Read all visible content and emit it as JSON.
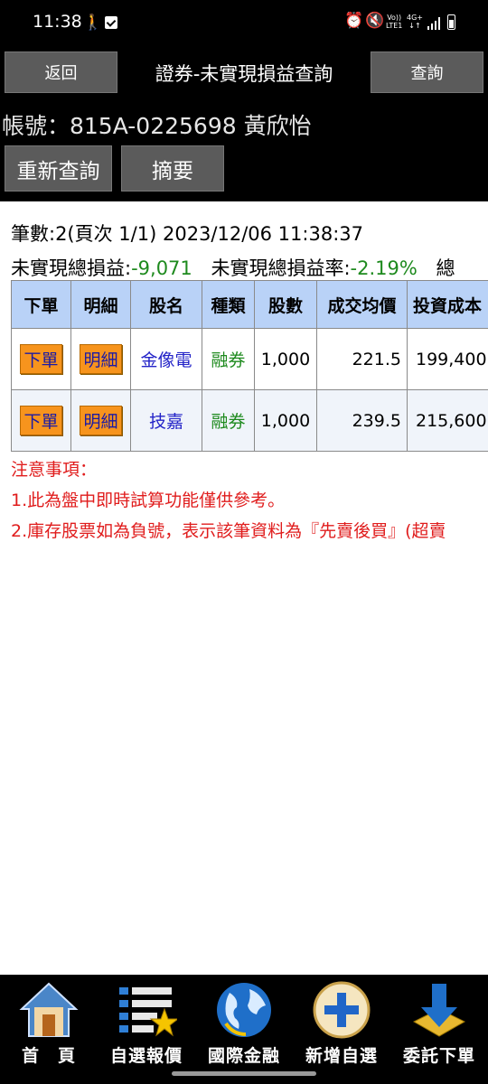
{
  "status_bar": {
    "time": "11:38",
    "volte_top": "Vo))",
    "volte_bottom": "LTE1",
    "net_top": "4G+",
    "net_bottom": "↓↑"
  },
  "header": {
    "back_label": "返回",
    "title": "證券-未實現損益查詢",
    "query_label": "查詢",
    "account": "帳號：815A-0225698 黃欣怡",
    "requery_label": "重新查詢",
    "summary_label": "摘要"
  },
  "info": {
    "line1": "筆數:2(頁次 1/1) 2023/12/06 11:38:37",
    "pl_label": "未實現總損益:",
    "pl_value": "-9,071",
    "rate_label": "未實現總損益率:",
    "rate_value": "-2.19%",
    "trailing": "總"
  },
  "table": {
    "headers": [
      "下單",
      "明細",
      "股名",
      "種類",
      "股數",
      "成交均價",
      "投資成本"
    ],
    "rows": [
      {
        "order": "下單",
        "detail": "明細",
        "name": "金像電",
        "type": "融券",
        "shares": "1,000",
        "avg_price": "221.5",
        "cost": "199,400"
      },
      {
        "order": "下單",
        "detail": "明細",
        "name": "技嘉",
        "type": "融券",
        "shares": "1,000",
        "avg_price": "239.5",
        "cost": "215,600"
      }
    ]
  },
  "notes": {
    "title": "注意事項：",
    "items": [
      "1.此為盤中即時試算功能僅供參考。",
      "2.庫存股票如為負號，表示該筆資料為『先賣後買』(超賣"
    ]
  },
  "nav": [
    {
      "label": "首　頁",
      "icon": "home-icon"
    },
    {
      "label": "自選報價",
      "icon": "watchlist-star-icon"
    },
    {
      "label": "國際金融",
      "icon": "globe-icon"
    },
    {
      "label": "新增自選",
      "icon": "add-plus-icon"
    },
    {
      "label": "委託下單",
      "icon": "order-download-arrow-icon"
    }
  ],
  "colors": {
    "header_bg": "#000000",
    "button_gray": "#5b5b5b",
    "table_header": "#b9d2f7",
    "order_button": "#f7941d",
    "negative": "#1e8a1e",
    "notes_red": "#e01c1c"
  }
}
